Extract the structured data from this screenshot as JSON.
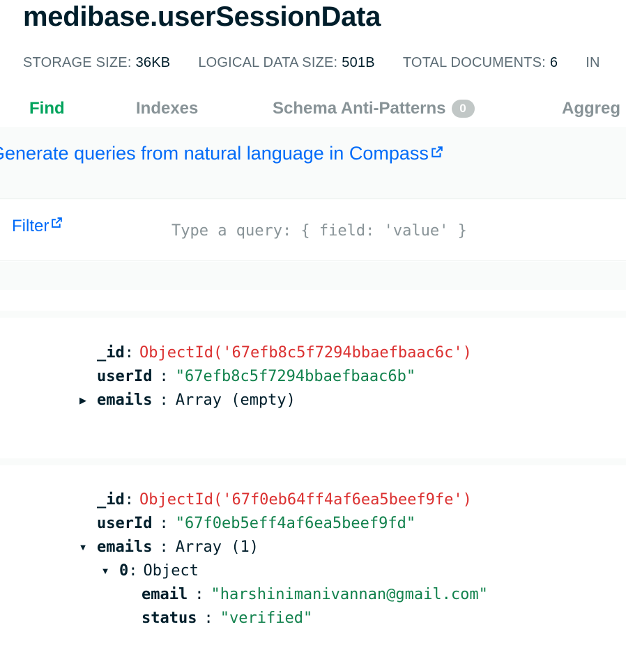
{
  "collection": {
    "title": "medibase.userSessionData"
  },
  "stats": [
    {
      "label": "STORAGE SIZE:",
      "value": "36KB"
    },
    {
      "label": "LOGICAL DATA SIZE:",
      "value": "501B"
    },
    {
      "label": "TOTAL DOCUMENTS:",
      "value": "6"
    },
    {
      "label": "IN",
      "value": ""
    }
  ],
  "tabs": [
    {
      "label": "Find",
      "active": true
    },
    {
      "label": "Indexes"
    },
    {
      "label": "Schema Anti-Patterns",
      "badge": "0"
    },
    {
      "label": "Aggreg"
    }
  ],
  "nl_banner": {
    "link_text": "Generate queries from natural language in Compass",
    "icon": "external-link-icon"
  },
  "filter": {
    "label": "Filter",
    "placeholder": "Type a query: { field: 'value' }",
    "icon": "external-link-icon"
  },
  "documents": [
    {
      "id_key": "_id",
      "id_value": "ObjectId('67efb8c5f7294bbaefbaac6c')",
      "userid_key": "userId",
      "userid_value": "\"67efb8c5f7294bbaefbaac6b\"",
      "emails_key": "emails",
      "emails_value": "Array (empty)",
      "emails_expanded": false
    },
    {
      "id_key": "_id",
      "id_value": "ObjectId('67f0eb64ff4af6ea5beef9fe')",
      "userid_key": "userId",
      "userid_value": "\"67f0eb5eff4af6ea5beef9fd\"",
      "emails_key": "emails",
      "emails_value": "Array (1)",
      "emails_expanded": true,
      "items": [
        {
          "index_key": "0",
          "index_value": "Object",
          "email_key": "email",
          "email_value": "\"harshinimanivannan@gmail.com\"",
          "status_key": "status",
          "status_value": "\"verified\""
        }
      ]
    }
  ],
  "colors": {
    "accent_green": "#00a35c",
    "link_blue": "#016bf8",
    "objectid_red": "#db3030",
    "string_green": "#12824d"
  }
}
